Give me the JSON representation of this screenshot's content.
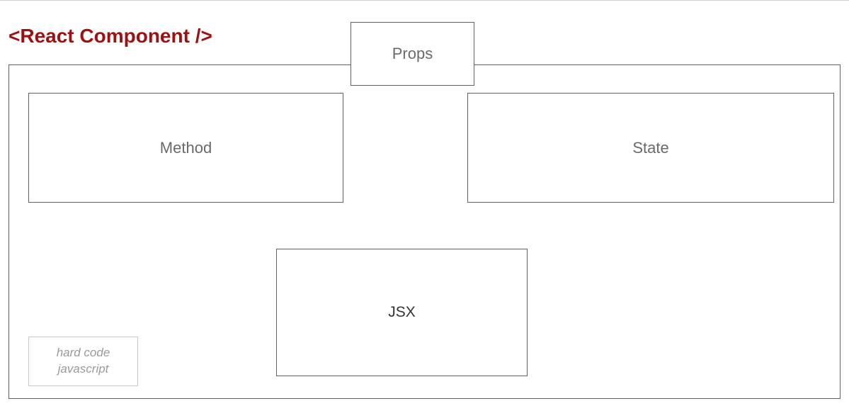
{
  "title": "<React Component />",
  "boxes": {
    "props": "Props",
    "method": "Method",
    "state": "State",
    "jsx": "JSX",
    "hardcode_line1": "hard code",
    "hardcode_line2": "javascript"
  }
}
